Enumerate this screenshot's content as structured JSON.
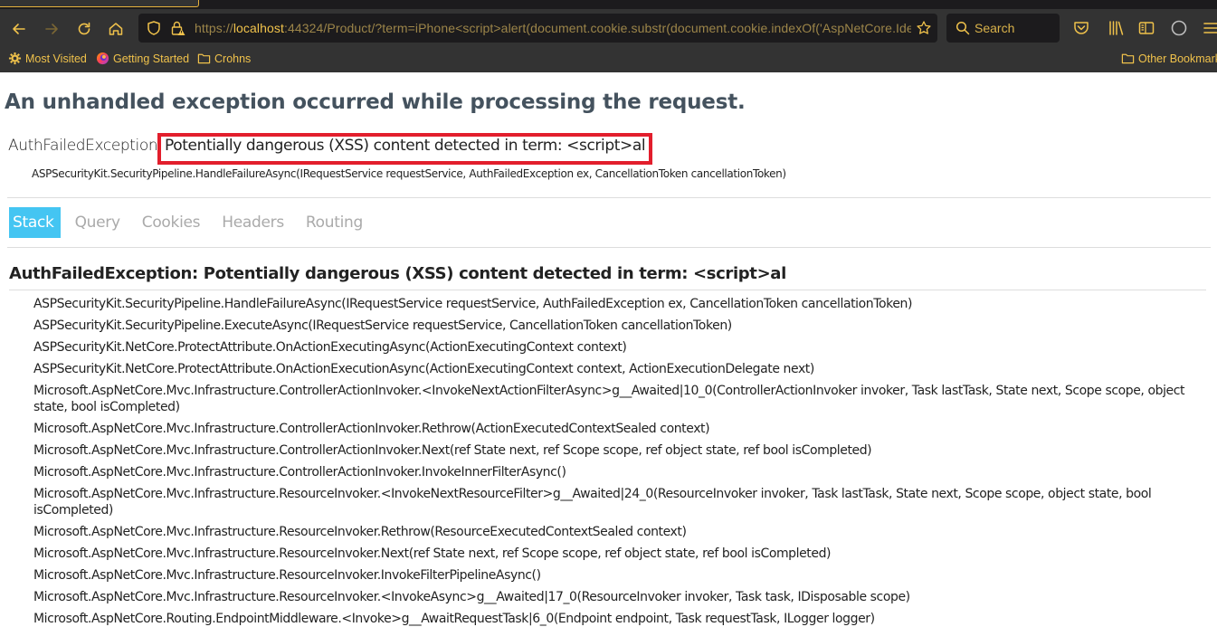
{
  "browser": {
    "url": {
      "scheme": "https://",
      "host": "localhost",
      "rest": ":44324/Product/?term=iPhone<script>alert(document.cookie.substr(document.cookie.indexOf('AspNetCore.Identity.Application"
    },
    "search_placeholder": "Search",
    "bookmarks": [
      {
        "label": "Most Visited",
        "icon": "gear-icon"
      },
      {
        "label": "Getting Started",
        "icon": "firefox-icon"
      },
      {
        "label": "Crohns",
        "icon": "folder-icon"
      }
    ],
    "other_bookmarks": "Other Bookmarks",
    "accent_color": "#f0c24b"
  },
  "page": {
    "title": "An unhandled exception occurred while processing the request.",
    "exception_type": "AuthFailedException:",
    "exception_message": "Potentially dangerous (XSS) content detected in term: <script>al",
    "exception_location": "ASPSecurityKit.SecurityPipeline.HandleFailureAsync(IRequestService requestService, AuthFailedException ex, CancellationToken cancellationToken)",
    "highlight_color": "#e21e2c",
    "tabs": [
      {
        "label": "Stack",
        "active": true
      },
      {
        "label": "Query",
        "active": false
      },
      {
        "label": "Cookies",
        "active": false
      },
      {
        "label": "Headers",
        "active": false
      },
      {
        "label": "Routing",
        "active": false
      }
    ],
    "active_tab_color": "#44c5f2",
    "stack_title": "AuthFailedException: Potentially dangerous (XSS) content detected in term: <script>al",
    "frames": [
      "ASPSecurityKit.SecurityPipeline.HandleFailureAsync(IRequestService requestService, AuthFailedException ex, CancellationToken cancellationToken)",
      "ASPSecurityKit.SecurityPipeline.ExecuteAsync(IRequestService requestService, CancellationToken cancellationToken)",
      "ASPSecurityKit.NetCore.ProtectAttribute.OnActionExecutingAsync(ActionExecutingContext context)",
      "ASPSecurityKit.NetCore.ProtectAttribute.OnActionExecutionAsync(ActionExecutingContext context, ActionExecutionDelegate next)",
      "Microsoft.AspNetCore.Mvc.Infrastructure.ControllerActionInvoker.<InvokeNextActionFilterAsync>g__Awaited|10_0(ControllerActionInvoker invoker, Task lastTask, State next, Scope scope, object state, bool isCompleted)",
      "Microsoft.AspNetCore.Mvc.Infrastructure.ControllerActionInvoker.Rethrow(ActionExecutedContextSealed context)",
      "Microsoft.AspNetCore.Mvc.Infrastructure.ControllerActionInvoker.Next(ref State next, ref Scope scope, ref object state, ref bool isCompleted)",
      "Microsoft.AspNetCore.Mvc.Infrastructure.ControllerActionInvoker.InvokeInnerFilterAsync()",
      "Microsoft.AspNetCore.Mvc.Infrastructure.ResourceInvoker.<InvokeNextResourceFilter>g__Awaited|24_0(ResourceInvoker invoker, Task lastTask, State next, Scope scope, object state, bool isCompleted)",
      "Microsoft.AspNetCore.Mvc.Infrastructure.ResourceInvoker.Rethrow(ResourceExecutedContextSealed context)",
      "Microsoft.AspNetCore.Mvc.Infrastructure.ResourceInvoker.Next(ref State next, ref Scope scope, ref object state, ref bool isCompleted)",
      "Microsoft.AspNetCore.Mvc.Infrastructure.ResourceInvoker.InvokeFilterPipelineAsync()",
      "Microsoft.AspNetCore.Mvc.Infrastructure.ResourceInvoker.<InvokeAsync>g__Awaited|17_0(ResourceInvoker invoker, Task task, IDisposable scope)",
      "Microsoft.AspNetCore.Routing.EndpointMiddleware.<Invoke>g__AwaitRequestTask|6_0(Endpoint endpoint, Task requestTask, ILogger logger)"
    ]
  }
}
